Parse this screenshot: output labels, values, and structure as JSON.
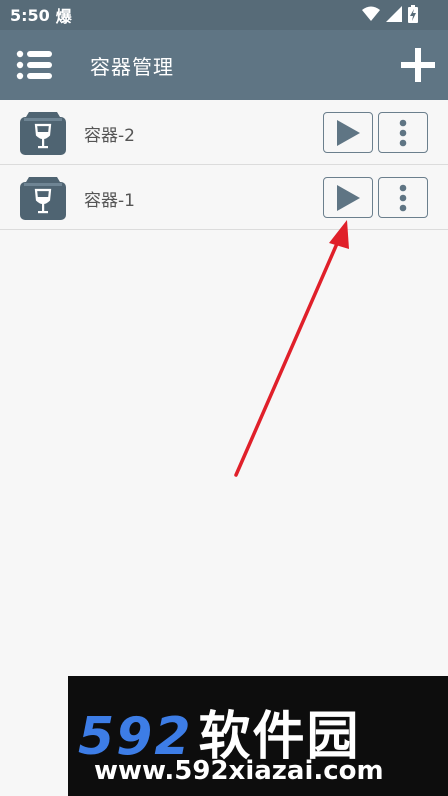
{
  "status_bar": {
    "time": "5:50",
    "notification_glyph": "爆",
    "icons": [
      "wifi-icon",
      "signal-icon",
      "battery-charging-icon"
    ]
  },
  "app_bar": {
    "title": "容器管理",
    "menu_icon": "list-menu-icon",
    "add_icon": "plus-icon"
  },
  "containers": [
    {
      "name": "容器-2",
      "icon": "wine-glass-box-icon"
    },
    {
      "name": "容器-1",
      "icon": "wine-glass-box-icon"
    }
  ],
  "watermark": {
    "logo_number": "592",
    "logo_text": "软件园",
    "url": "www.592xiazai.com"
  },
  "colors": {
    "app_bar": "#5f7584",
    "status_bar": "#576b78",
    "button_border": "#6b7f8d",
    "annotation_arrow": "#e0202a",
    "watermark_blue": "#3d7de6"
  }
}
